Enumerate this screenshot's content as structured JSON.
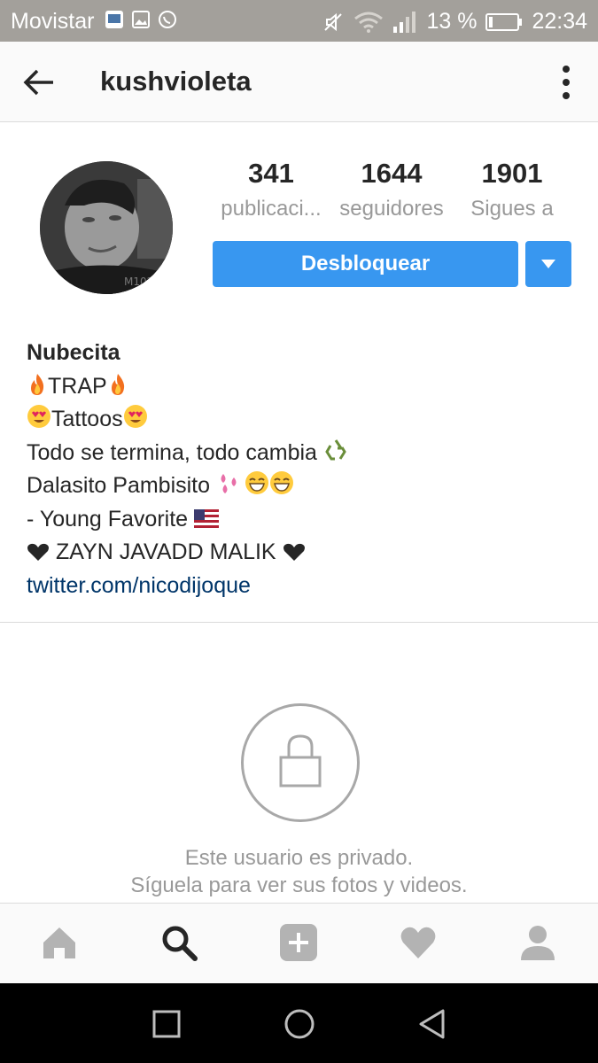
{
  "status_bar": {
    "carrier": "Movistar",
    "battery_percent": "13 %",
    "time": "22:34",
    "icons": [
      "screen-icon",
      "image-icon",
      "whatsapp-icon",
      "mute-icon",
      "wifi-icon",
      "signal-icon",
      "battery-icon"
    ]
  },
  "app_bar": {
    "username": "kushvioleta",
    "icons": [
      "back-arrow-icon",
      "more-vertical-icon"
    ]
  },
  "profile": {
    "stats": [
      {
        "value": "341",
        "label": "publicaci..."
      },
      {
        "value": "1644",
        "label": "seguidores"
      },
      {
        "value": "1901",
        "label": "Sigues a"
      }
    ],
    "unblock_label": "Desbloquear"
  },
  "bio": {
    "name": "Nubecita",
    "line1": "TRAP",
    "line2": "Tattoos",
    "line3": "Todo se termina, todo cambia",
    "line4": "Dalasito Pambisito",
    "line5": "- Young Favorite",
    "line6": "ZAYN JAVADD MALIK",
    "link": "twitter.com/nicodijoque"
  },
  "private": {
    "line1": "Este usuario es privado.",
    "line2": "Síguela para ver sus fotos y videos."
  },
  "tab_bar": {
    "items": [
      "home-icon",
      "search-icon",
      "add-post-icon",
      "heart-icon",
      "profile-icon"
    ],
    "active": "search-icon"
  },
  "colors": {
    "accent": "#3897f0",
    "link": "#003569",
    "status_bar": "#a3a09b"
  }
}
